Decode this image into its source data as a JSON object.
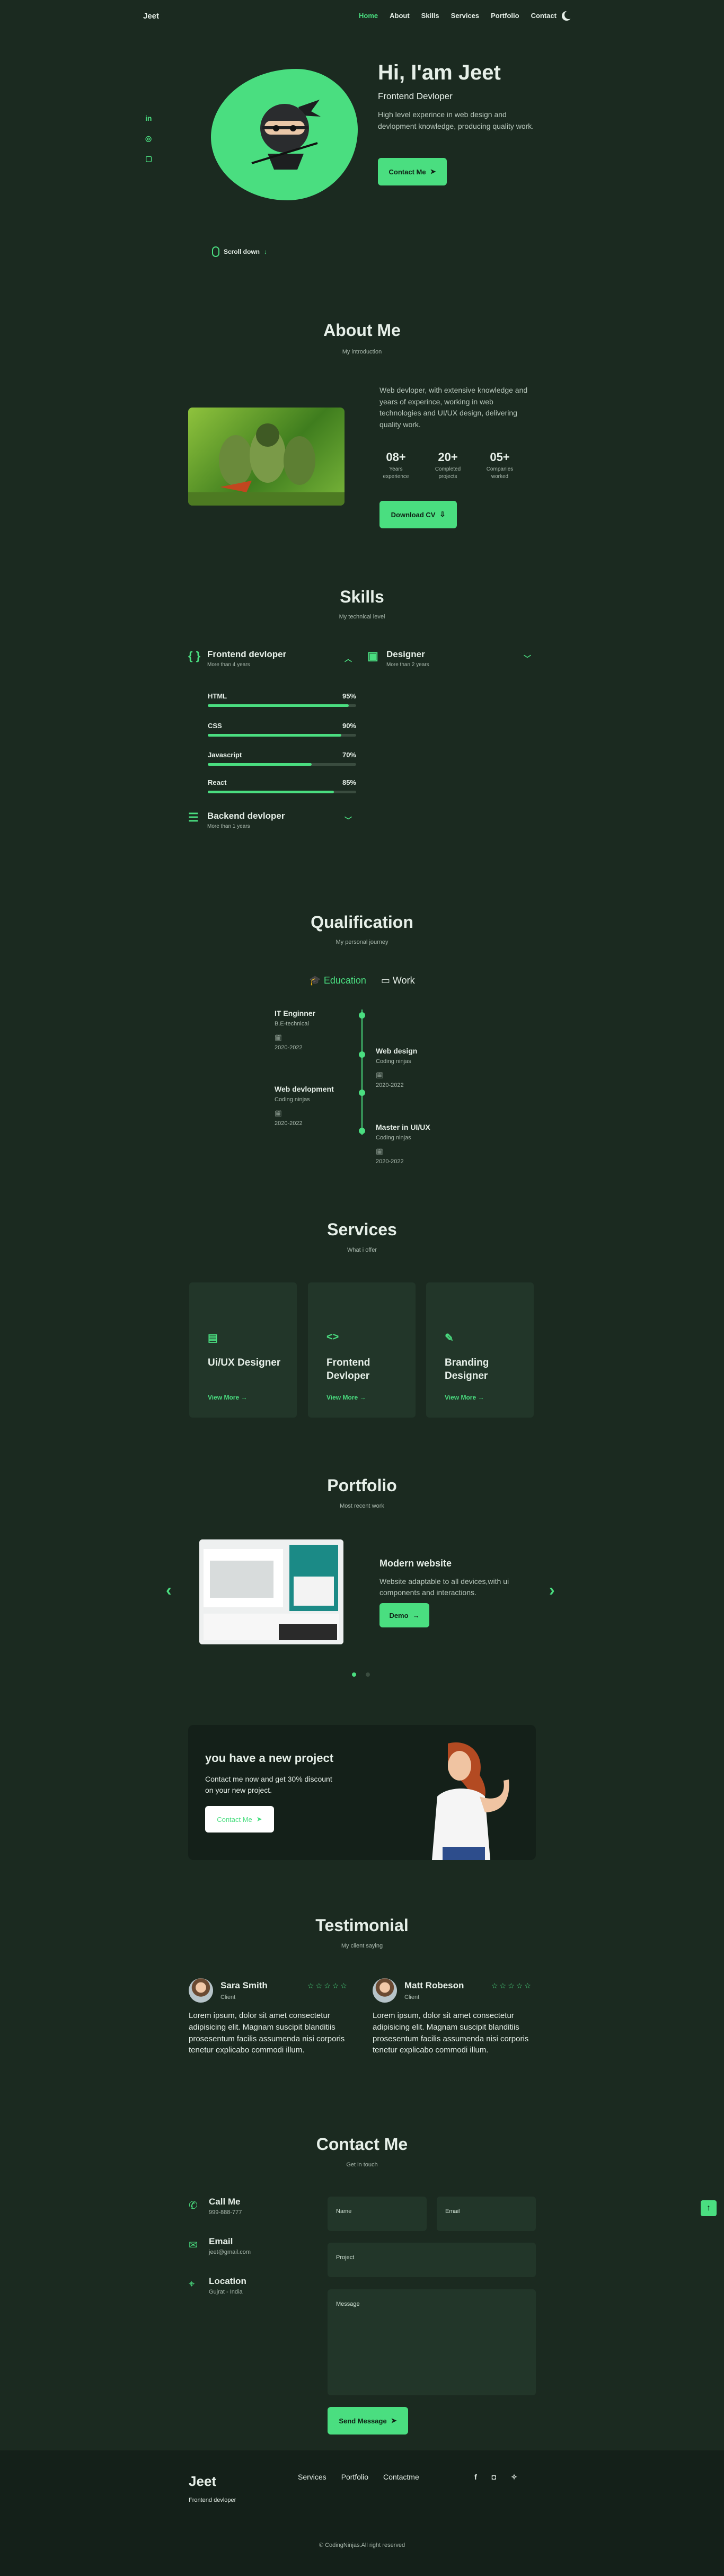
{
  "header": {
    "brand": "Jeet",
    "nav": [
      "Home",
      "About",
      "Skills",
      "Services",
      "Portfolio",
      "Contact"
    ]
  },
  "hero": {
    "title": "Hi, I'am Jeet",
    "subtitle": "Frontend Devloper",
    "description": "High level experince in web design and devlopment knowledge, producing quality work.",
    "button": "Contact Me",
    "scroll": "Scroll down"
  },
  "about": {
    "title": "About Me",
    "subtitle": "My introduction",
    "description": "Web devloper, with extensive knowledge and years of experince, working in web technologies and UI/UX design, delivering quality work.",
    "stats": [
      {
        "value": "08+",
        "label": "Years experience"
      },
      {
        "value": "20+",
        "label": "Completed projects"
      },
      {
        "value": "05+",
        "label": "Companies worked"
      }
    ],
    "button": "Download CV"
  },
  "skills": {
    "title": "Skills",
    "subtitle": "My technical level",
    "frontend": {
      "title": "Frontend devloper",
      "sub": "More than 4 years"
    },
    "designer": {
      "title": "Designer",
      "sub": "More than 2 years"
    },
    "backend": {
      "title": "Backend devloper",
      "sub": "More than 1 years"
    },
    "bars": [
      {
        "name": "HTML",
        "percent_label": "95%",
        "value": 95
      },
      {
        "name": "CSS",
        "percent_label": "90%",
        "value": 90
      },
      {
        "name": "Javascript",
        "percent_label": "70%",
        "value": 70
      },
      {
        "name": "React",
        "percent_label": "85%",
        "value": 85
      }
    ]
  },
  "qualification": {
    "title": "Qualification",
    "subtitle": "My personal journey",
    "tabs": [
      "Education",
      "Work"
    ],
    "items": [
      {
        "title": "IT Enginner",
        "sub": "B.E-technical",
        "date": "2020-2022"
      },
      {
        "title": "Web design",
        "sub": "Coding ninjas",
        "date": "2020-2022"
      },
      {
        "title": "Web devlopment",
        "sub": "Coding ninjas",
        "date": "2020-2022"
      },
      {
        "title": "Master in UI/UX",
        "sub": "Coding ninjas",
        "date": "2020-2022"
      }
    ]
  },
  "services": {
    "title": "Services",
    "subtitle": "What i offer",
    "cards": [
      {
        "title": "Ui/UX Designer",
        "link": "View More"
      },
      {
        "title": "Frontend Devloper",
        "link": "View More"
      },
      {
        "title": "Branding Designer",
        "link": "View More"
      }
    ]
  },
  "portfolio": {
    "title": "Portfolio",
    "subtitle": "Most recent work",
    "item_title": "Modern website",
    "item_desc": "Website adaptable to all devices,with ui components and interactions.",
    "button": "Demo"
  },
  "project": {
    "title": "you have a new project",
    "desc": "Contact me now and get 30% discount on your new project.",
    "button": "Contact Me"
  },
  "testimonial": {
    "title": "Testimonial",
    "subtitle": "My client saying",
    "items": [
      {
        "name": "Sara Smith",
        "role": "Client",
        "text": "Lorem ipsum, dolor sit amet consectetur adipisicing elit. Magnam suscipit blanditiis prosesentum facilis assumenda nisi corporis tenetur explicabo commodi illum."
      },
      {
        "name": "Matt Robeson",
        "role": "Client",
        "text": "Lorem ipsum, dolor sit amet consectetur adipisicing elit. Magnam suscipit blanditiis prosesentum facilis assumenda nisi corporis tenetur explicabo commodi illum."
      }
    ]
  },
  "contact": {
    "title": "Contact Me",
    "subtitle": "Get in touch",
    "info": [
      {
        "title": "Call Me",
        "value": "999-888-777"
      },
      {
        "title": "Email",
        "value": "jeet@gmail.com"
      },
      {
        "title": "Location",
        "value": "Gujrat - India"
      }
    ],
    "fields": {
      "name": "Name",
      "email": "Email",
      "project": "Project",
      "message": "Message"
    },
    "button": "Send Message"
  },
  "footer": {
    "logo": "Jeet",
    "sub": "Frontend devloper",
    "links": [
      "Services",
      "Portfolio",
      "Contactme"
    ],
    "copyright": "© CodingNinjas.All right reserved"
  },
  "colors": {
    "accent": "#4ade80",
    "background": "#1b2a20"
  }
}
